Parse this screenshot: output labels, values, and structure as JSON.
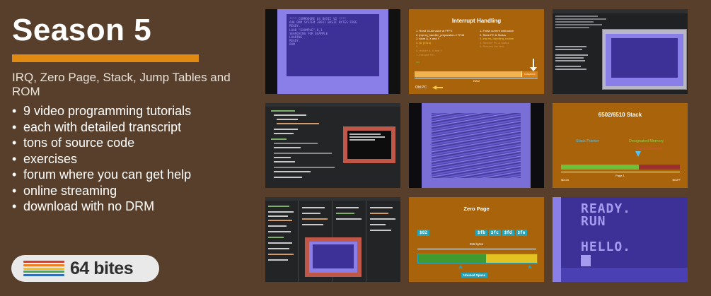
{
  "left": {
    "title": "Season 5",
    "subtitle": "IRQ, Zero Page, Stack, Jump Tables and ROM",
    "features": [
      "9 video programming tutorials",
      "each with detailed transcript",
      "tons of source code",
      "exercises",
      "forum where you can get help",
      "online streaming",
      "download with no DRM"
    ],
    "logo": {
      "text": "64 bites",
      "stripe_colors": [
        "#e0392b",
        "#f07d1e",
        "#f4c21d",
        "#4aaa4e",
        "#2f6fb5"
      ]
    }
  },
  "thumbnails": {
    "t1": {
      "lines": [
        "**** COMMODORE 64 BASIC V2 ****",
        "64K RAM SYSTEM 38911 BASIC BYTES FREE",
        "READY.",
        "LOAD \"EXAMPLE\",8,1",
        "SEARCHING FOR EXAMPLE",
        "LOADING",
        "READY.",
        "RUN"
      ]
    },
    "t2": {
      "title": "Interrupt Handling",
      "left_steps": [
        "1. Read 16-bit value at FFFE",
        "2. jmp irq_handler_preparation // FF48",
        "3. store A, X and Y",
        "4. jsr (0314)"
      ],
      "left_faded": [
        "5. ...",
        "6. restore A, X and Y",
        "7. execute RTI"
      ],
      "right_steps": [
        "1. Finish current instruction",
        "2. Store PC & Status"
      ],
      "right_highlight": "3. jmp irq_handling_routine",
      "right_faded": [
        "4. Restore PC & Status",
        "5. Resume the task"
      ],
      "ram_label": "RAM",
      "vector_label": "FFFE/FFFF",
      "old_pc_label": "Old PC"
    },
    "t6": {
      "title": "6502/6510 Stack",
      "stack_pointer": "Stack Pointer",
      "designated_memory": "Designated Memory",
      "stack_contents": "Stack Contents",
      "page_label": "Page 1",
      "start_addr": "$0100",
      "end_addr": "$01FF"
    },
    "t8": {
      "title": "Zero Page",
      "left_box": "$02",
      "right_boxes": [
        "$fb",
        "$fc",
        "$fd",
        "$fe"
      ],
      "bytes_label": "256 bytes",
      "unused_label": "Unused Space",
      "bar_colors": {
        "used": "#3f9b2f",
        "unused": "#e3c321"
      },
      "used_fraction": 0.57
    },
    "t9": {
      "lines": [
        "READY.",
        "RUN",
        "",
        "HELLO."
      ]
    }
  }
}
